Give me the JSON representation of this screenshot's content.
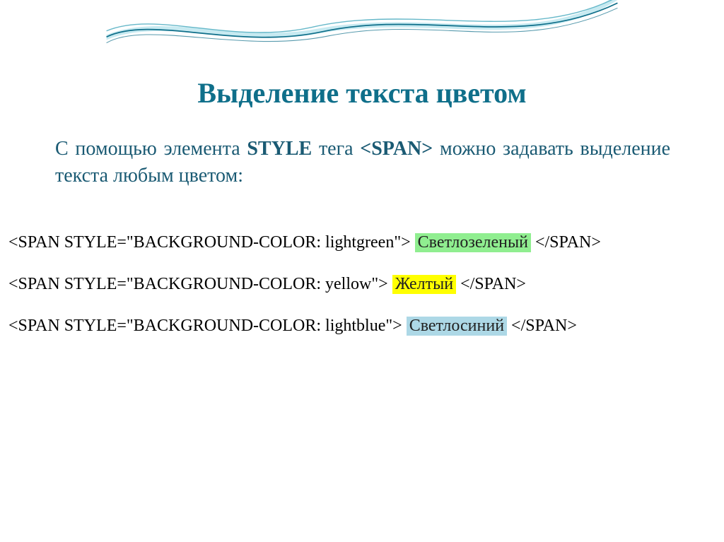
{
  "title": "Выделение текста цветом",
  "body": {
    "part1": "С помощью элемента ",
    "style_word": "STYLE",
    "part2": " тега ",
    "span_word": "<SPAN>",
    "part3": " можно задавать выделение текста любым цветом:"
  },
  "examples": [
    {
      "opening": "<SPAN STYLE=\"BACKGROUND-COLOR: lightgreen\"> ",
      "highlight_text": "Светлозеленый ",
      "closing": "</SPAN>",
      "color": "#90ee90"
    },
    {
      "opening": "<SPAN STYLE=\"BACKGROUND-COLOR: yellow\"> ",
      "highlight_text": "Желтый ",
      "closing": "</SPAN>",
      "color": "#ffff00"
    },
    {
      "opening": "<SPAN STYLE=\"BACKGROUND-COLOR: lightblue\"> ",
      "highlight_text": "Светлосиний ",
      "closing": "</SPAN>",
      "color": "#add8e6"
    }
  ]
}
